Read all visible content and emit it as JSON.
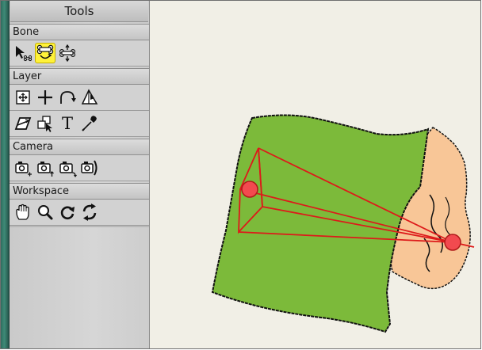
{
  "panel": {
    "title": "Tools",
    "sections": [
      {
        "label": "Bone",
        "tools": [
          {
            "icon": "select-bone-icon"
          },
          {
            "icon": "transform-bone-icon",
            "active": true
          },
          {
            "icon": "bone-strength-icon"
          }
        ]
      },
      {
        "label": "Layer",
        "tools": [
          {
            "icon": "transform-layer-icon"
          },
          {
            "icon": "set-origin-icon"
          },
          {
            "icon": "follow-path-icon"
          },
          {
            "icon": "rotate-layer-xy-icon"
          },
          {
            "icon": "shear-layer-icon"
          },
          {
            "icon": "switch-layer-icon"
          },
          {
            "icon": "text-tool-icon",
            "glyph": "T"
          },
          {
            "icon": "eyedropper-icon"
          }
        ]
      },
      {
        "label": "Camera",
        "tools": [
          {
            "icon": "track-camera-icon"
          },
          {
            "icon": "zoom-camera-icon"
          },
          {
            "icon": "roll-camera-icon"
          },
          {
            "icon": "pan-tilt-camera-icon"
          }
        ]
      },
      {
        "label": "Workspace",
        "tools": [
          {
            "icon": "hand-pan-icon"
          },
          {
            "icon": "magnifier-icon"
          },
          {
            "icon": "orbit-icon"
          },
          {
            "icon": "rotate-workspace-icon"
          }
        ]
      }
    ]
  },
  "colors": {
    "active_tool": "#fff23a",
    "green_layer": "#7cba3a",
    "peach_layer": "#f8c697",
    "bone": "#dd1a1a"
  }
}
